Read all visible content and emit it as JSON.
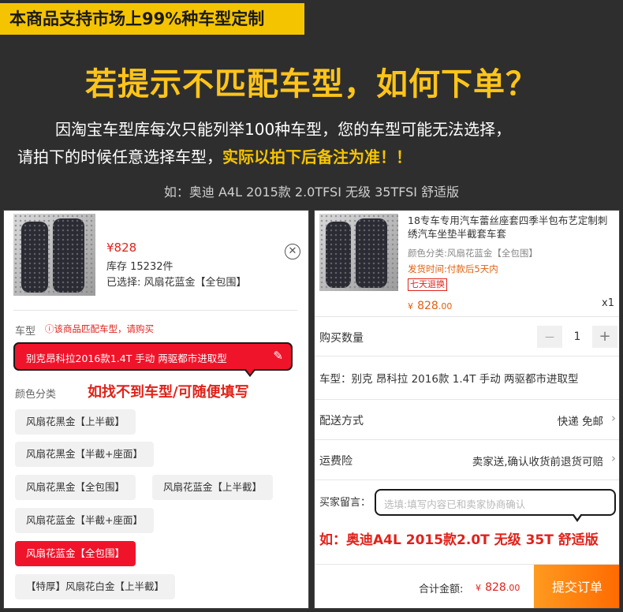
{
  "banner": {
    "badge": "本商品支持市场上99%种车型定制",
    "headline": "若提示不匹配车型，如何下单？",
    "line1": "因淘宝车型库每次只能列举100种车型，您的车型可能无法选择，",
    "line2_prefix": "请拍下的时候任意选择车型，",
    "line2_highlight": "实际以拍下后备注为准！！",
    "example": "如：奥迪 A4L 2015款 2.0TFSI 无级 35TFSI 舒适版"
  },
  "left_panel": {
    "price": "¥828",
    "stock": "库存 15232件",
    "selected": "已选择: 风扇花蓝金【全包围】",
    "car_model_label": "车型",
    "warning": "ⓘ该商品匹配车型，请购买",
    "car_model_value": "别克昂科拉2016款1.4T 手动 两驱都市进取型",
    "callout": "如找不到车型/可随便填写",
    "color_label": "颜色分类",
    "options": [
      "风扇花黑金【上半截】",
      "风扇花黑金【半截+座面】",
      "风扇花黑金【全包围】",
      "风扇花蓝金【上半截】",
      "风扇花蓝金【半截+座面】",
      "风扇花蓝金【全包围】",
      "【特厚】风扇花白金【上半截】"
    ]
  },
  "right_panel": {
    "product_title": "18专车专用汽车蕾丝座套四季半包布艺定制刺绣汽车坐垫半截套车套",
    "color_spec": "颜色分类:风扇花蓝金【全包围】",
    "ship_time": "发货时间:付款后5天内",
    "return_tag": "七天退换",
    "unit_price_symbol": "¥",
    "unit_price_int": "828",
    "unit_price_dec": ".00",
    "qty_multiplier": "x1",
    "qty_label": "购买数量",
    "qty_minus": "—",
    "qty_value": "1",
    "qty_plus": "+",
    "car_model": "车型：别克 昂科拉 2016款 1.4T 手动 两驱都市进取型",
    "shipping_label": "配送方式",
    "shipping_value": "快递 免邮",
    "insurance_label": "运费险",
    "insurance_value": "卖家送,确认收货前退货可赔",
    "message_label": "买家留言：",
    "message_placeholder": "选填:填写内容已和卖家协商确认",
    "message_example": "如：奥迪A4L 2015款2.0T 无级 35T 舒适版",
    "total_label": "合计金额:",
    "total_symbol": "¥",
    "total_int": "828",
    "total_dec": ".00",
    "submit": "提交订单"
  }
}
